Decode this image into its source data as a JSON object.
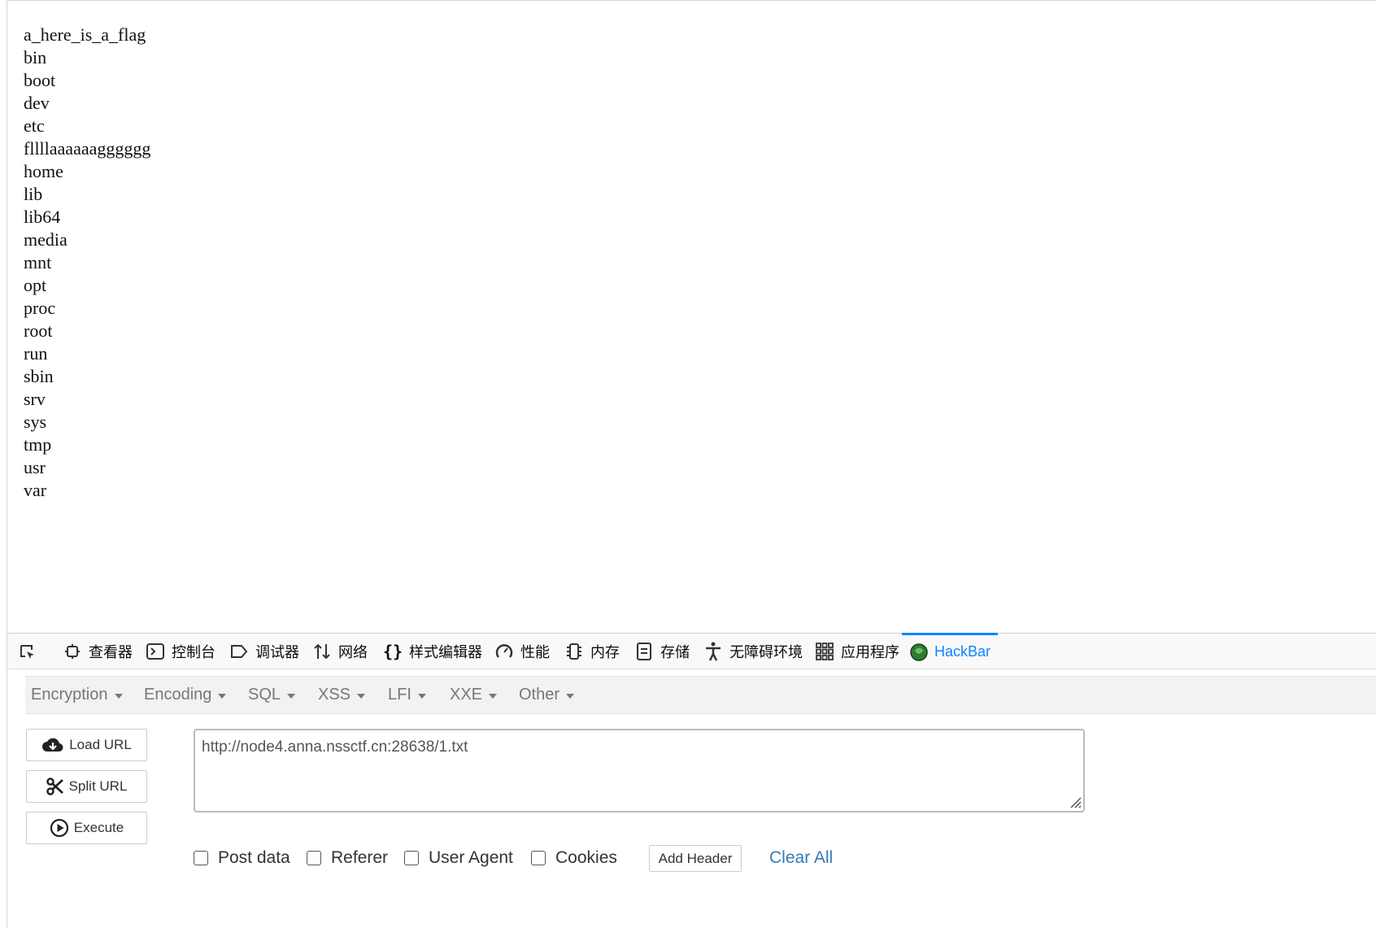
{
  "page": {
    "entries": [
      "a_here_is_a_flag",
      "bin",
      "boot",
      "dev",
      "etc",
      "fllllaaaaaagggggg",
      "home",
      "lib",
      "lib64",
      "media",
      "mnt",
      "opt",
      "proc",
      "root",
      "run",
      "sbin",
      "srv",
      "sys",
      "tmp",
      "usr",
      "var"
    ]
  },
  "devtools": {
    "tabs": [
      {
        "label": "查看器",
        "icon": "inspector-icon"
      },
      {
        "label": "控制台",
        "icon": "console-icon"
      },
      {
        "label": "调试器",
        "icon": "debugger-icon"
      },
      {
        "label": "网络",
        "icon": "network-icon"
      },
      {
        "label": "样式编辑器",
        "icon": "style-editor-icon"
      },
      {
        "label": "性能",
        "icon": "performance-icon"
      },
      {
        "label": "内存",
        "icon": "memory-icon"
      },
      {
        "label": "存储",
        "icon": "storage-icon"
      },
      {
        "label": "无障碍环境",
        "icon": "accessibility-icon"
      },
      {
        "label": "应用程序",
        "icon": "application-icon"
      },
      {
        "label": "HackBar",
        "icon": "hackbar-icon"
      }
    ],
    "active_tab": "HackBar",
    "accent_color": "#0a84ff"
  },
  "hackbar": {
    "menus": [
      "Encryption",
      "Encoding",
      "SQL",
      "XSS",
      "LFI",
      "XXE",
      "Other"
    ],
    "buttons": {
      "load": "Load URL",
      "split": "Split URL",
      "execute": "Execute"
    },
    "url": "http://node4.anna.nssctf.cn:28638/1.txt",
    "options": {
      "post": "Post data",
      "referer": "Referer",
      "user_agent": "User Agent",
      "cookies": "Cookies"
    },
    "add_header": "Add Header",
    "clear_all": "Clear All",
    "link_color": "#337ab7"
  }
}
